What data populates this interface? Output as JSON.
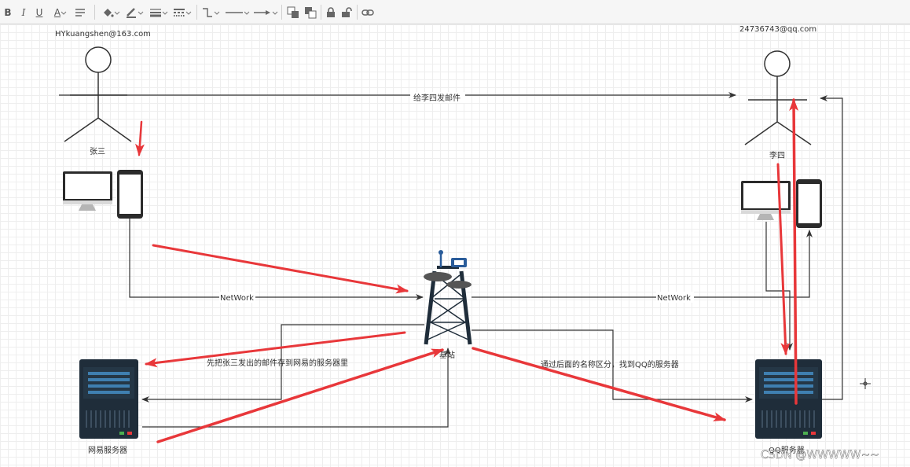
{
  "toolbar": {
    "bold": "B",
    "italic": "I",
    "underline": "U",
    "font_color": "A",
    "tools": [
      "font-color",
      "fill-color-icon",
      "line-color-icon",
      "line-width-icon",
      "line-dash-icon",
      "connector-icon",
      "line-style-icon",
      "arrow-style-icon",
      "to-front-icon",
      "to-back-icon",
      "lock-icon",
      "unlock-icon",
      "link-icon"
    ]
  },
  "diagram": {
    "sender_email": "HYkuangshen@163.com",
    "receiver_email": "24736743@qq.com",
    "sender_name": "张三",
    "receiver_name": "李四",
    "send_mail_label": "给李四发邮件",
    "network_left": "NetWork",
    "network_right": "NetWork",
    "base_station": "基站",
    "store_note": "先把张三发出的邮件存到网易的服务器里",
    "route_note": "通过后面的名称区分，找到QQ的服务器",
    "netease_server": "网易服务器",
    "qq_server": "QQ服务器",
    "watermark": "CSDN @WWWWW~~"
  },
  "colors": {
    "highlight_arrow": "#e8373a",
    "connector": "#333333",
    "server_body": "#1f2d3a",
    "server_panel": "#3f7fb0",
    "tower_blue": "#2a5c9a",
    "device_dark": "#2b2b2b"
  }
}
